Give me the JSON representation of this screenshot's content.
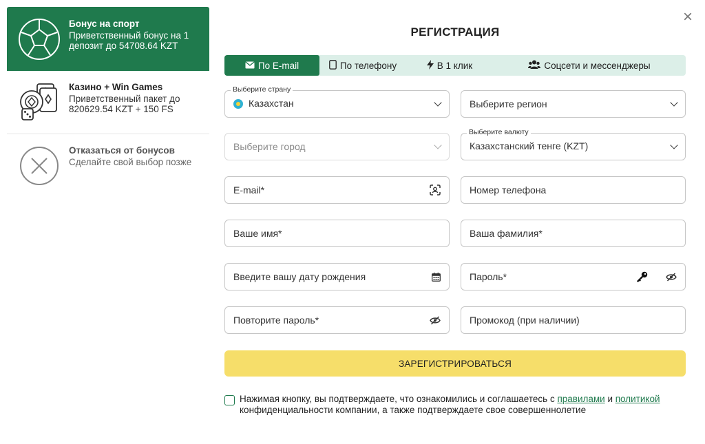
{
  "bonuses": [
    {
      "title": "Бонус на спорт",
      "desc": "Приветственный бонус на 1 депозит до 54708.64 KZT",
      "icon": "soccer-ball-icon"
    },
    {
      "title": "Казино + Win Games",
      "desc": "Приветственный пакет до 820629.54 KZT + 150 FS",
      "icon": "casino-chips-cards-icon"
    },
    {
      "title": "Отказаться от бонусов",
      "desc": "Сделайте свой выбор позже",
      "icon": "decline-x-icon"
    }
  ],
  "close_symbol": "×",
  "form": {
    "title": "РЕГИСТРАЦИЯ",
    "tabs": [
      {
        "label": "По E-mail",
        "icon": "envelope-icon"
      },
      {
        "label": "По телефону",
        "icon": "phone-icon"
      },
      {
        "label": "В 1 клик",
        "icon": "lightning-icon"
      },
      {
        "label": "Соцсети и мессенджеры",
        "icon": "people-icon"
      }
    ],
    "country_legend": "Выберите страну",
    "country_value": "Казахстан",
    "region_placeholder": "Выберите регион",
    "city_placeholder": "Выберите город",
    "currency_legend": "Выберите валюту",
    "currency_value": "Казахстанский тенге (KZT)",
    "email_placeholder": "E-mail*",
    "phone_placeholder": "Номер телефона",
    "first_name_placeholder": "Ваше имя*",
    "last_name_placeholder": "Ваша фамилия*",
    "birthdate_placeholder": "Введите вашу дату рождения",
    "password_placeholder": "Пароль*",
    "repeat_password_placeholder": "Повторите пароль*",
    "promo_placeholder": "Промокод (при наличии)",
    "submit_label": "ЗАРЕГИСТРИРОВАТЬСЯ",
    "agree_text_1": "Нажимая кнопку, вы подтверждаете, что ознакомились и соглашаетесь с ",
    "agree_link_rules": "правилами",
    "agree_text_2": " и ",
    "agree_link_policy": "политикой",
    "agree_text_3": " конфиденциальности компании, а также подтверждаете свое совершеннолетие"
  },
  "colors": {
    "brand_green": "#1f7a4d",
    "tab_bg": "#dcefe8",
    "submit_yellow": "#f6de6a"
  }
}
